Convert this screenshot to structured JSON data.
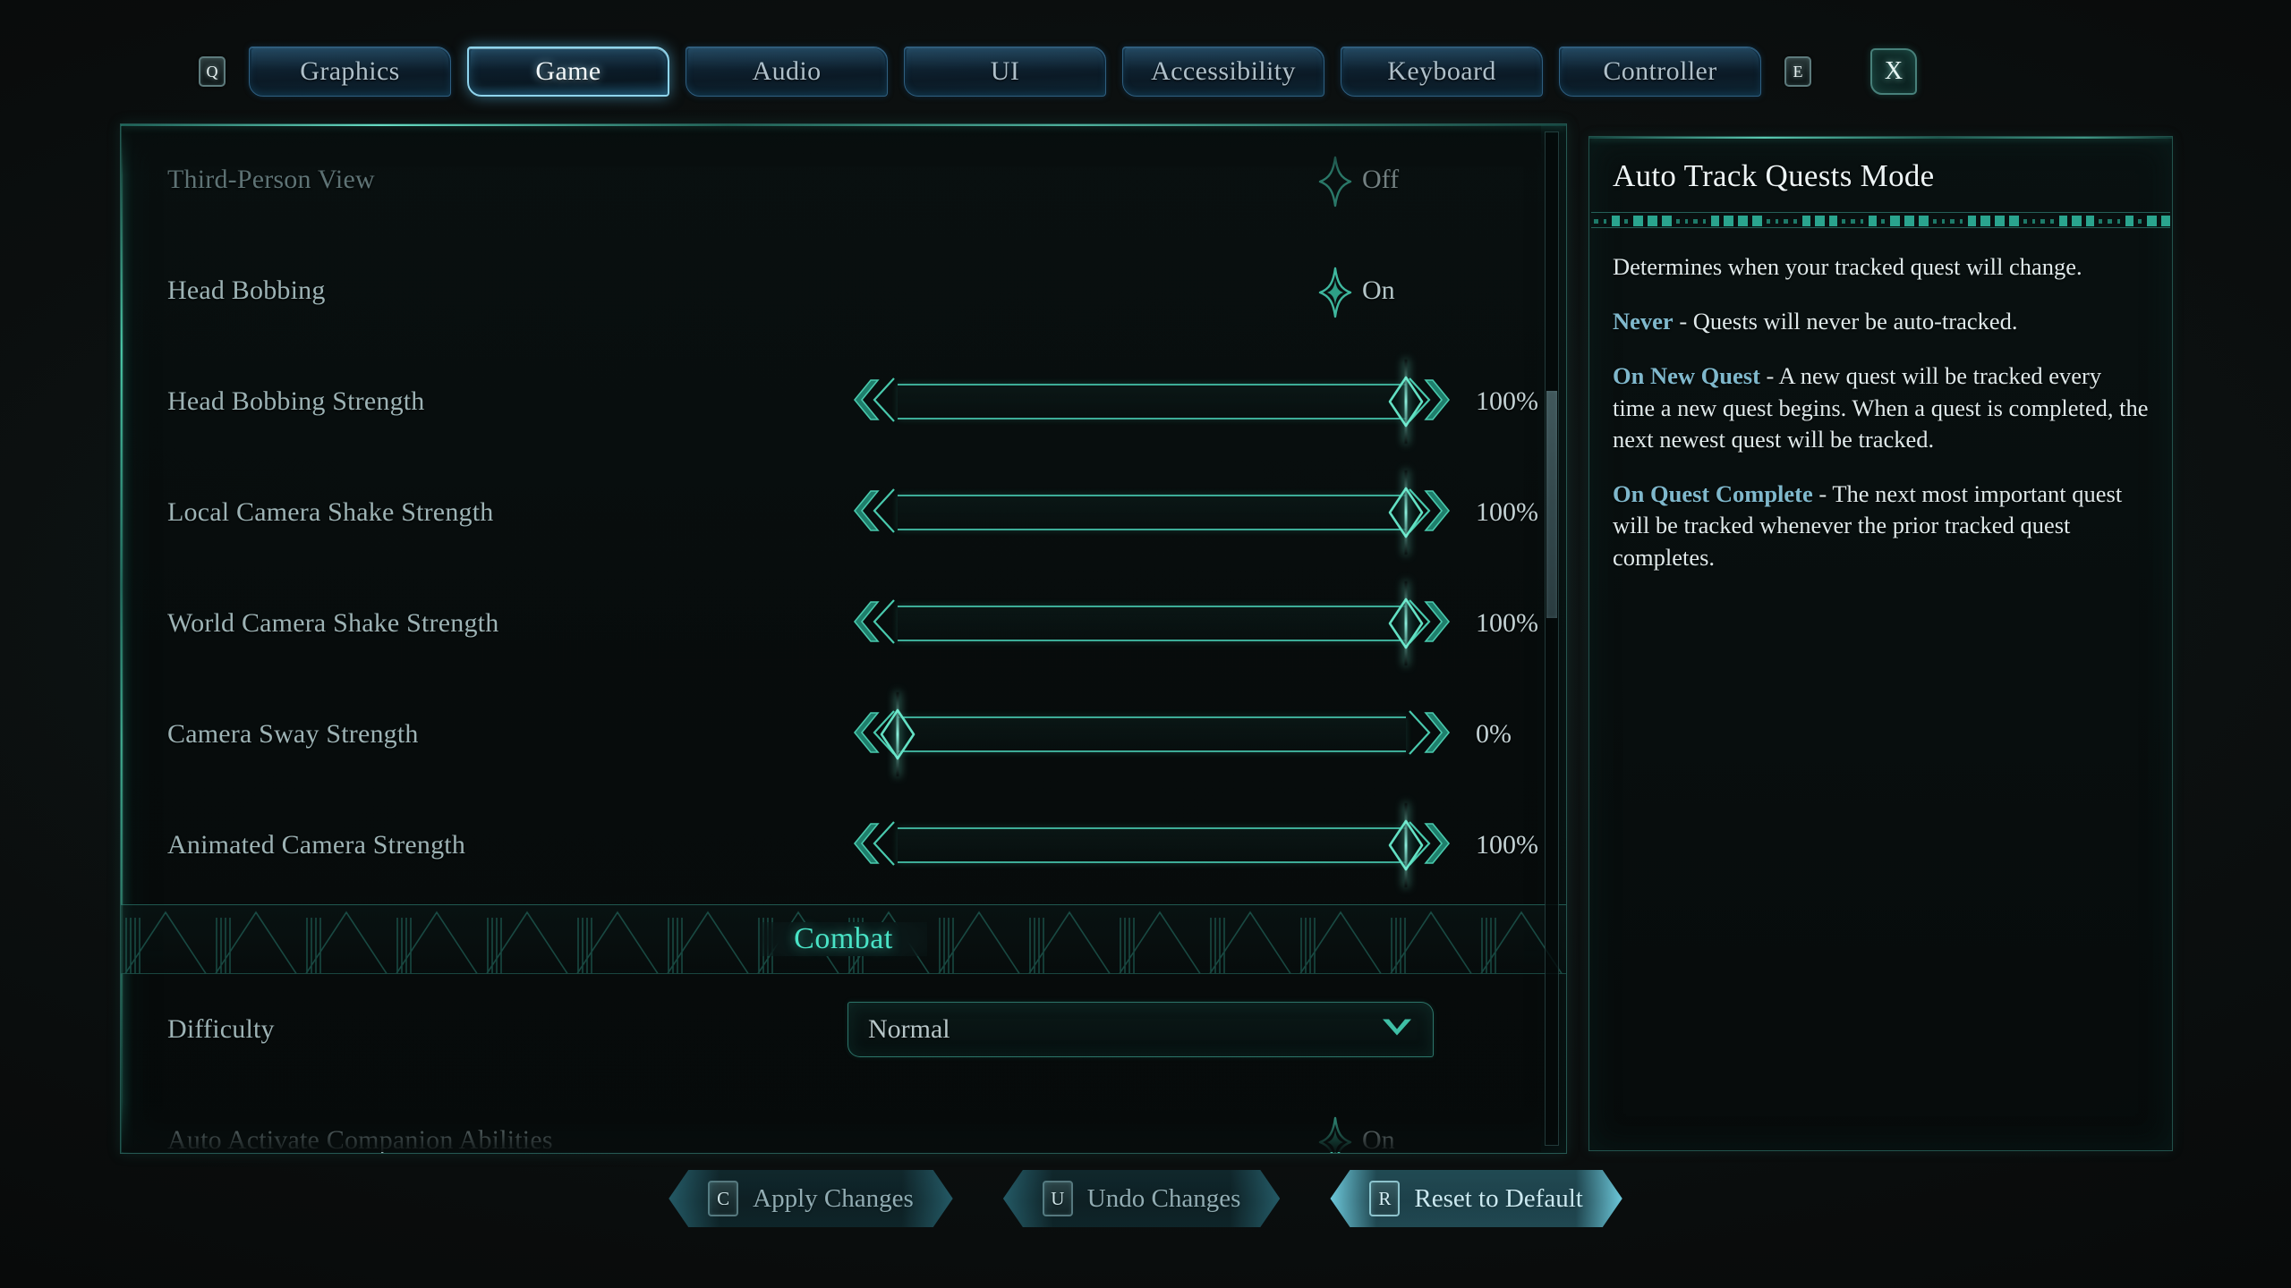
{
  "tabbar": {
    "left_key": "Q",
    "right_key": "E",
    "close_label": "X",
    "tabs": [
      {
        "label": "Graphics",
        "active": false
      },
      {
        "label": "Game",
        "active": true
      },
      {
        "label": "Audio",
        "active": false
      },
      {
        "label": "UI",
        "active": false
      },
      {
        "label": "Accessibility",
        "active": false
      },
      {
        "label": "Keyboard",
        "active": false
      },
      {
        "label": "Controller",
        "active": false
      }
    ]
  },
  "settings": {
    "rows": [
      {
        "type": "toggle",
        "label": "Third-Person View",
        "value": "Off",
        "on": false,
        "dim": true
      },
      {
        "type": "toggle",
        "label": "Head Bobbing",
        "value": "On",
        "on": true,
        "dim": false
      },
      {
        "type": "slider",
        "label": "Head Bobbing Strength",
        "value": "100%",
        "percent": 100
      },
      {
        "type": "slider",
        "label": "Local Camera Shake Strength",
        "value": "100%",
        "percent": 100
      },
      {
        "type": "slider",
        "label": "World Camera Shake Strength",
        "value": "100%",
        "percent": 100
      },
      {
        "type": "slider",
        "label": "Camera Sway Strength",
        "value": "0%",
        "percent": 0
      },
      {
        "type": "slider",
        "label": "Animated Camera Strength",
        "value": "100%",
        "percent": 100
      },
      {
        "type": "section",
        "label": "Combat"
      },
      {
        "type": "dropdown",
        "label": "Difficulty",
        "value": "Normal"
      },
      {
        "type": "toggle",
        "label": "Auto Activate Companion Abilities",
        "value": "On",
        "on": true,
        "dim": false
      }
    ]
  },
  "info": {
    "title": "Auto Track Quests Mode",
    "intro": "Determines when your tracked quest will change.",
    "entries": [
      {
        "term": "Never",
        "text": " - Quests will never be auto-tracked."
      },
      {
        "term": "On New Quest",
        "text": " - A new quest will be tracked every time a new quest begins. When a quest is completed, the next newest quest will be tracked."
      },
      {
        "term": "On Quest Complete",
        "text": " - The next most important quest will be tracked whenever the prior tracked quest completes."
      }
    ]
  },
  "footer": {
    "buttons": [
      {
        "key": "C",
        "label": "Apply Changes",
        "highlight": false
      },
      {
        "key": "U",
        "label": "Undo Changes",
        "highlight": false
      },
      {
        "key": "R",
        "label": "Reset to Default",
        "highlight": true
      }
    ]
  },
  "colors": {
    "accent_teal": "#46c8af",
    "accent_blue": "#8fd4ec",
    "section_title": "#49e3c6",
    "term_blue": "#7fb8cc",
    "background": "#090b0b"
  }
}
